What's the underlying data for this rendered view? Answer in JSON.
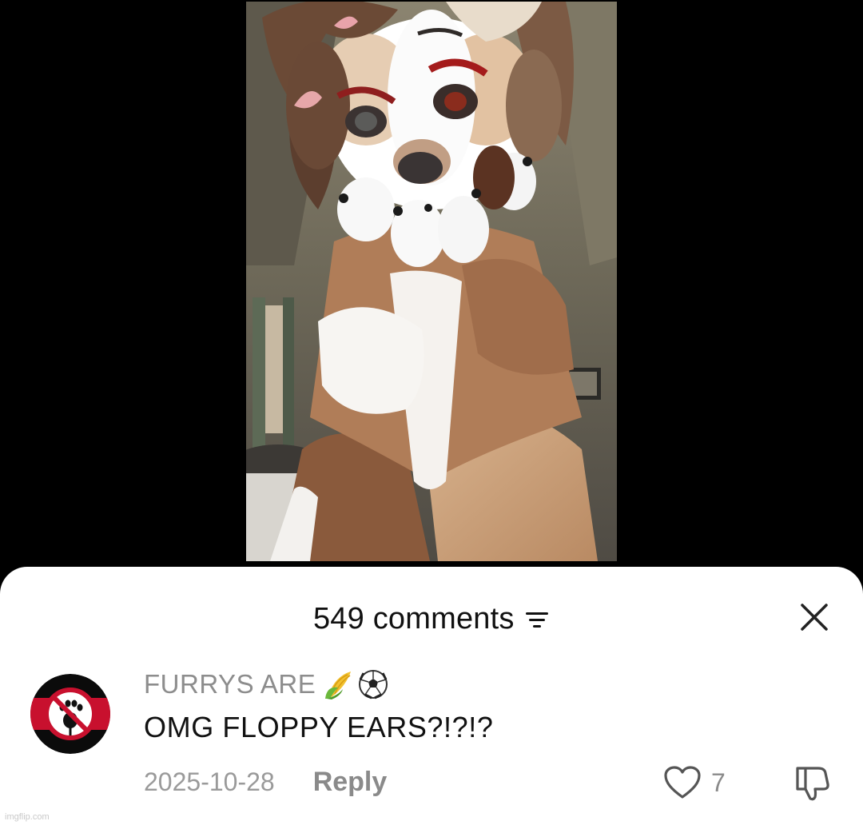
{
  "video": {
    "description_icon": "video-frame"
  },
  "comments_sheet": {
    "title": "549 comments",
    "sort_icon": "sort-icon",
    "close_icon": "close-icon"
  },
  "comment": {
    "username": "FURRYS ARE",
    "username_emojis": [
      "corn-emoji",
      "soccer-ball-emoji"
    ],
    "text": "OMG FLOPPY EARS?!?!?",
    "date": "2025-10-28",
    "reply_label": "Reply",
    "like_count": "7",
    "like_icon": "heart-icon",
    "dislike_icon": "thumbs-down-icon"
  },
  "watermark": "imgflip.com",
  "colors": {
    "sheet_bg": "#ffffff",
    "page_bg": "#000000",
    "muted_text": "#8d8d8d",
    "avatar_red": "#c8102e"
  }
}
